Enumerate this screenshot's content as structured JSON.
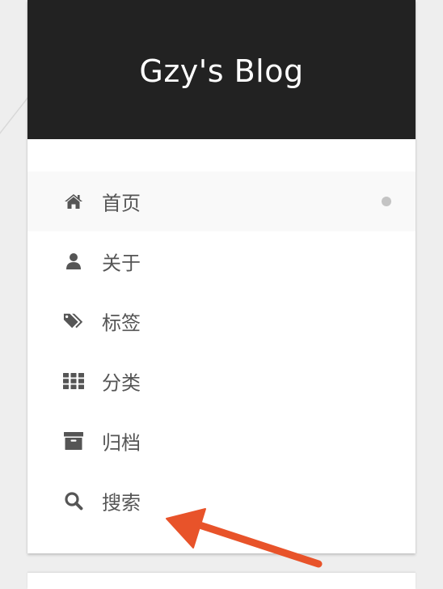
{
  "site": {
    "title": "Gzy's Blog"
  },
  "menu": {
    "items": [
      {
        "label": "首页",
        "icon": "home-icon",
        "active": true
      },
      {
        "label": "关于",
        "icon": "user-icon",
        "active": false
      },
      {
        "label": "标签",
        "icon": "tags-icon",
        "active": false
      },
      {
        "label": "分类",
        "icon": "grid-icon",
        "active": false
      },
      {
        "label": "归档",
        "icon": "archive-icon",
        "active": false
      },
      {
        "label": "搜索",
        "icon": "search-icon",
        "active": false
      }
    ]
  },
  "annotation": {
    "arrow_color": "#e8532a",
    "arrow_icon": "annotation-arrow-icon"
  },
  "colors": {
    "page_background": "#eeeeee",
    "brand_background": "#222222",
    "brand_text": "#ffffff",
    "menu_text": "#555555",
    "active_item_background": "#f9f9f9",
    "active_dot": "#c4c4c4"
  }
}
